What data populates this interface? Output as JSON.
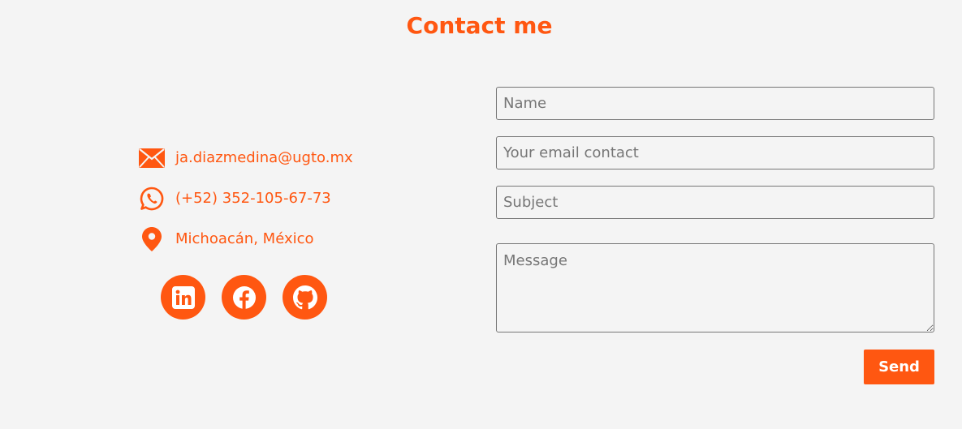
{
  "page": {
    "title": "Contact me"
  },
  "contact": {
    "email": "ja.diazmedina@ugto.mx",
    "phone": "(+52) 352-105-67-73",
    "location": "Michoacán, México"
  },
  "socials": [
    {
      "icon": "linkedin-icon"
    },
    {
      "icon": "facebook-icon"
    },
    {
      "icon": "github-icon"
    }
  ],
  "form": {
    "name_placeholder": "Name",
    "email_placeholder": "Your email contact",
    "subject_placeholder": "Subject",
    "message_placeholder": "Message",
    "send_label": "Send"
  },
  "colors": {
    "accent": "#ff5711",
    "background": "#f4f4f4"
  }
}
